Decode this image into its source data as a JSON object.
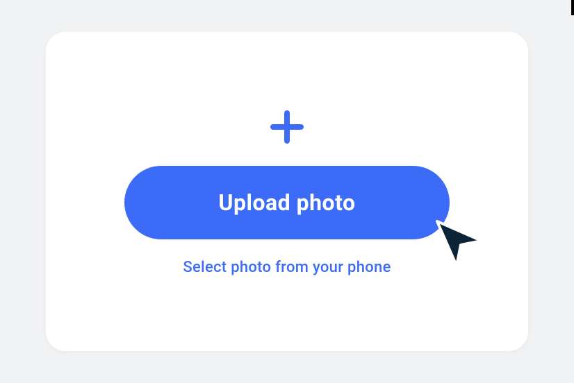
{
  "upload": {
    "button_label": "Upload photo",
    "helper_text": "Select photo from your phone"
  },
  "colors": {
    "primary": "#3c6cf7",
    "background": "#f1f2f3",
    "card": "#ffffff",
    "cursor": "#0d2436"
  }
}
